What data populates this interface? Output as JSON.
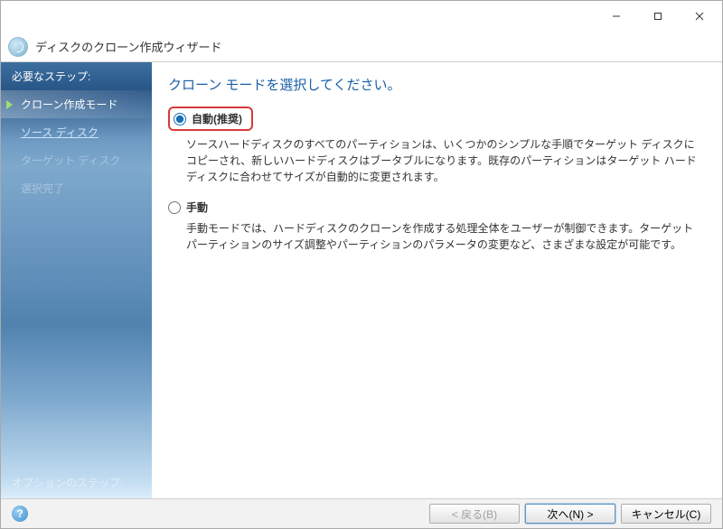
{
  "window": {
    "title": "ディスクのクローン作成ウィザード"
  },
  "sidebar": {
    "header": "必要なステップ:",
    "steps": [
      {
        "label": "クローン作成モード"
      },
      {
        "label": "ソース ディスク"
      },
      {
        "label": "ターゲット ディスク"
      },
      {
        "label": "選択完了"
      }
    ],
    "footer": "オプションのステップ:"
  },
  "main": {
    "title": "クローン モードを選択してください。",
    "options": [
      {
        "label": "自動(推奨)",
        "desc": "ソースハードディスクのすべてのパーティションは、いくつかのシンプルな手順でターゲット ディスクにコピーされ、新しいハードディスクはブータブルになります。既存のパーティションはターゲット ハードディスクに合わせてサイズが自動的に変更されます。"
      },
      {
        "label": "手動",
        "desc": "手動モードでは、ハードディスクのクローンを作成する処理全体をユーザーが制御できます。ターゲット パーティションのサイズ調整やパーティションのパラメータの変更など、さまざまな設定が可能です。"
      }
    ]
  },
  "footer": {
    "back": "< 戻る(B)",
    "next": "次へ(N) >",
    "cancel": "キャンセル(C)"
  }
}
